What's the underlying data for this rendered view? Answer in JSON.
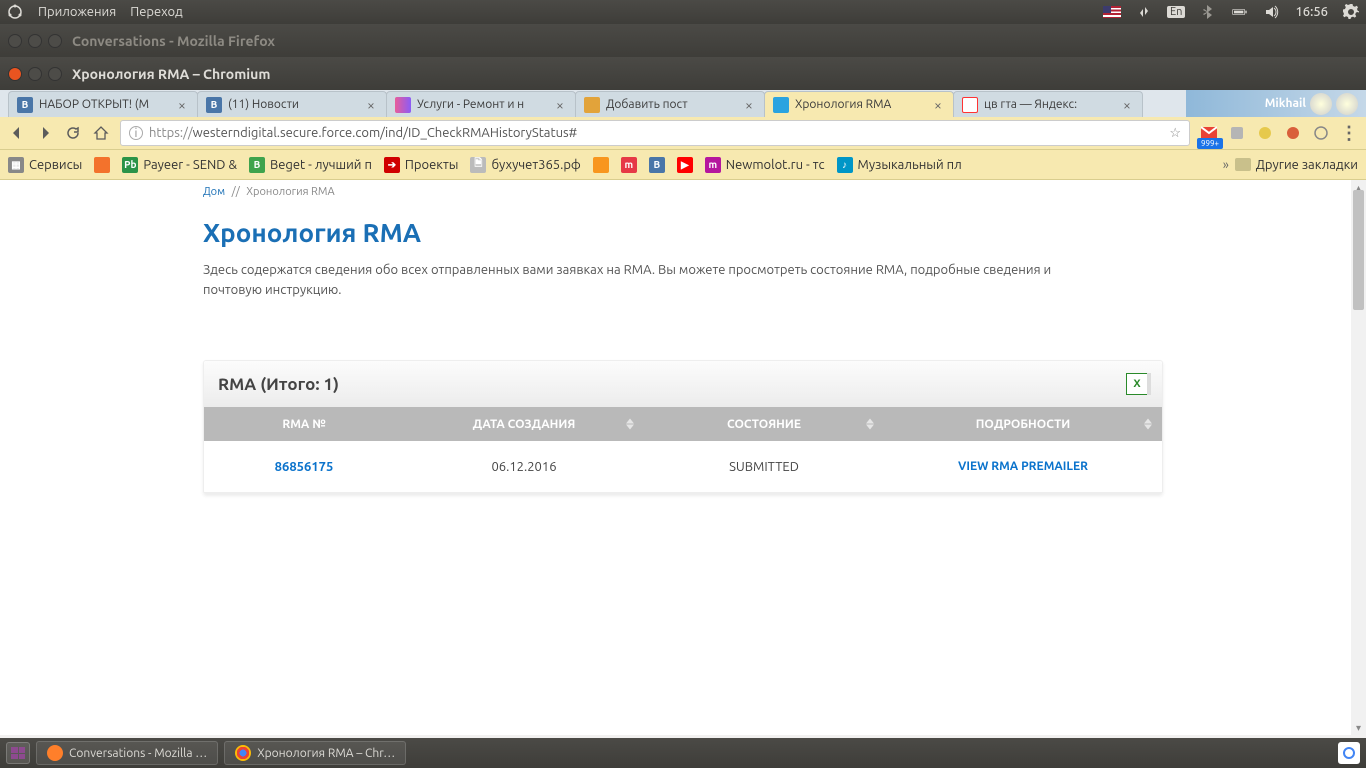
{
  "ubuntu": {
    "apps": "Приложения",
    "go": "Переход",
    "lang": "En",
    "time": "16:56"
  },
  "firefox_window_title": "Conversations - Mozilla Firefox",
  "chromium_window_title": "Хронология RMA – Chromium",
  "tabs": [
    {
      "title": "НАБОР ОТКРЫТ! (М"
    },
    {
      "title": "(11) Новости"
    },
    {
      "title": "Услуги - Ремонт и н"
    },
    {
      "title": "Добавить пост"
    },
    {
      "title": "Хронология RMA"
    },
    {
      "title": "цв гта — Яндекс:"
    }
  ],
  "user_badge": "Mikhail",
  "url": {
    "scheme": "https://",
    "rest": "westerndigital.secure.force.com/ind/ID_CheckRMAHistoryStatus#"
  },
  "gmail_badge": "999+",
  "bookmarks": {
    "apps": "Сервисы",
    "payeer": "Payeer - SEND &",
    "beget": "Beget - лучший п",
    "projects": "Проекты",
    "buh": "бухучет365.рф",
    "newmolot": "Newmolot.ru - тс",
    "music": "Музыкальный пл",
    "other": "Другие закладки"
  },
  "breadcrumb": {
    "home": "Дом",
    "sep": "//",
    "current": "Хронология RMA"
  },
  "page": {
    "title": "Хронология RMA",
    "desc": "Здесь содержатся сведения обо всех отправленных вами заявках на RMA. Вы можете просмотреть состояние RMA, подробные сведения и почтовую инструкцию."
  },
  "panel": {
    "title": "RMA (Итого: 1)",
    "columns": {
      "rma_no": "RMA №",
      "created": "ДАТА СОЗДАНИЯ",
      "status": "СОСТОЯНИЕ",
      "details": "ПОДРОБНОСТИ"
    },
    "rows": [
      {
        "rma_no": "86856175",
        "created": "06.12.2016",
        "status": "SUBMITTED",
        "details": "VIEW RMA PREMAILER"
      }
    ]
  },
  "taskbar": {
    "firefox": "Conversations - Mozilla …",
    "chromium": "Хронология RMA – Chr…"
  }
}
